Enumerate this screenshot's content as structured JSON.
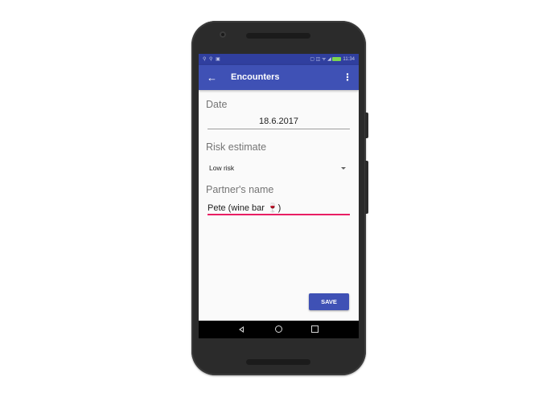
{
  "statusbar": {
    "left_icons": "⚲ ⚲ ▣",
    "right_icons": "▢ ◫ ᯤ ◢",
    "time": "11:34"
  },
  "appbar": {
    "title": "Encounters",
    "back_icon": "arrow-left-icon",
    "menu_icon": "overflow-menu-icon"
  },
  "form": {
    "date_label": "Date",
    "date_value": "18.6.2017",
    "risk_label": "Risk estimate",
    "risk_value": "Low risk",
    "partner_label": "Partner's name",
    "partner_value": "Pete (wine bar 🍷)"
  },
  "save_label": "SAVE",
  "colors": {
    "primary": "#3f51b5",
    "primary_dark": "#303f9f",
    "accent": "#e91e63"
  }
}
